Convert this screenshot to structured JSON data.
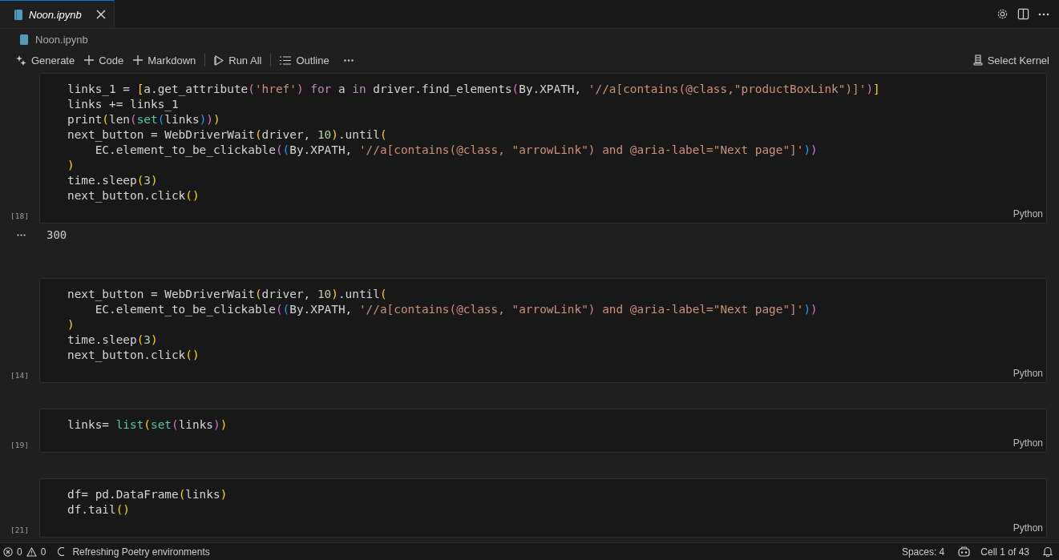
{
  "tabs": [
    {
      "label": "Noon.ipynb",
      "selected": true
    }
  ],
  "breadcrumb": "Noon.ipynb",
  "toolbar": {
    "items": [
      {
        "label": "Generate",
        "kind": "sparkle"
      },
      {
        "label": "Code",
        "kind": "plus"
      },
      {
        "label": "Markdown",
        "kind": "plus"
      },
      {
        "label": "Run All",
        "kind": "run"
      },
      {
        "label": "Outline",
        "kind": "list"
      }
    ],
    "kernel": "Select Kernel"
  },
  "cells": [
    {
      "count": "[18]",
      "language": "Python",
      "lines": [
        [
          {
            "text": "links_1 = ",
            "kind": "plain"
          },
          {
            "text": "[",
            "kind": "bracket1"
          },
          {
            "text": "a.get_attribute",
            "kind": "plain"
          },
          {
            "text": "(",
            "kind": "bracket2"
          },
          {
            "text": "'href'",
            "kind": "string"
          },
          {
            "text": ")",
            "kind": "bracket2"
          },
          {
            "text": " for ",
            "kind": "keyword"
          },
          {
            "text": "a",
            "kind": "plain"
          },
          {
            "text": " in ",
            "kind": "keyword"
          },
          {
            "text": "driver.find_elements",
            "kind": "plain"
          },
          {
            "text": "(",
            "kind": "bracket2"
          },
          {
            "text": "By.XPATH, ",
            "kind": "plain"
          },
          {
            "text": "'//a[contains(@class,\"productBoxLink\")]'",
            "kind": "string"
          },
          {
            "text": ")",
            "kind": "bracket2"
          },
          {
            "text": "]",
            "kind": "bracket1"
          }
        ],
        [
          {
            "text": "links += links_1",
            "kind": "plain"
          }
        ],
        [
          {
            "text": "print",
            "kind": "plain"
          },
          {
            "text": "(",
            "kind": "bracket1"
          },
          {
            "text": "len",
            "kind": "plain"
          },
          {
            "text": "(",
            "kind": "bracket2"
          },
          {
            "text": "set",
            "kind": "builtin"
          },
          {
            "text": "(",
            "kind": "bracket3"
          },
          {
            "text": "links",
            "kind": "plain"
          },
          {
            "text": ")",
            "kind": "bracket3"
          },
          {
            "text": ")",
            "kind": "bracket2"
          },
          {
            "text": ")",
            "kind": "bracket1"
          }
        ],
        [
          {
            "text": "next_button = WebDriverWait",
            "kind": "plain"
          },
          {
            "text": "(",
            "kind": "bracket1"
          },
          {
            "text": "driver, ",
            "kind": "plain"
          },
          {
            "text": "10",
            "kind": "number"
          },
          {
            "text": ")",
            "kind": "bracket1"
          },
          {
            "text": ".until",
            "kind": "plain"
          },
          {
            "text": "(",
            "kind": "bracket1"
          }
        ],
        [
          {
            "text": "    EC.element_to_be_clickable",
            "kind": "plain"
          },
          {
            "text": "(",
            "kind": "bracket2"
          },
          {
            "text": "(",
            "kind": "bracket3"
          },
          {
            "text": "By.XPATH, ",
            "kind": "plain"
          },
          {
            "text": "'//a[contains(@class, \"arrowLink\") and @aria-label=\"Next page\"]'",
            "kind": "string"
          },
          {
            "text": ")",
            "kind": "bracket3"
          },
          {
            "text": ")",
            "kind": "bracket2"
          }
        ],
        [
          {
            "text": ")",
            "kind": "bracket1"
          }
        ],
        [
          {
            "text": "time.sleep",
            "kind": "plain"
          },
          {
            "text": "(",
            "kind": "bracket1"
          },
          {
            "text": "3",
            "kind": "number"
          },
          {
            "text": ")",
            "kind": "bracket1"
          }
        ],
        [
          {
            "text": "next_button.click",
            "kind": "plain"
          },
          {
            "text": "()",
            "kind": "bracket1"
          }
        ]
      ],
      "output": "300"
    },
    {
      "count": "[14]",
      "language": "Python",
      "lines": [
        [
          {
            "text": "next_button = WebDriverWait",
            "kind": "plain"
          },
          {
            "text": "(",
            "kind": "bracket1"
          },
          {
            "text": "driver, ",
            "kind": "plain"
          },
          {
            "text": "10",
            "kind": "number"
          },
          {
            "text": ")",
            "kind": "bracket1"
          },
          {
            "text": ".until",
            "kind": "plain"
          },
          {
            "text": "(",
            "kind": "bracket1"
          }
        ],
        [
          {
            "text": "    EC.element_to_be_clickable",
            "kind": "plain"
          },
          {
            "text": "(",
            "kind": "bracket2"
          },
          {
            "text": "(",
            "kind": "bracket3"
          },
          {
            "text": "By.XPATH, ",
            "kind": "plain"
          },
          {
            "text": "'//a[contains(@class, \"arrowLink\") and @aria-label=\"Next page\"]'",
            "kind": "string"
          },
          {
            "text": ")",
            "kind": "bracket3"
          },
          {
            "text": ")",
            "kind": "bracket2"
          }
        ],
        [
          {
            "text": ")",
            "kind": "bracket1"
          }
        ],
        [
          {
            "text": "time.sleep",
            "kind": "plain"
          },
          {
            "text": "(",
            "kind": "bracket1"
          },
          {
            "text": "3",
            "kind": "number"
          },
          {
            "text": ")",
            "kind": "bracket1"
          }
        ],
        [
          {
            "text": "next_button.click",
            "kind": "plain"
          },
          {
            "text": "()",
            "kind": "bracket1"
          }
        ]
      ]
    },
    {
      "count": "[19]",
      "language": "Python",
      "lines": [
        [
          {
            "text": "links= ",
            "kind": "plain"
          },
          {
            "text": "list",
            "kind": "builtin"
          },
          {
            "text": "(",
            "kind": "bracket1"
          },
          {
            "text": "set",
            "kind": "builtin"
          },
          {
            "text": "(",
            "kind": "bracket2"
          },
          {
            "text": "links",
            "kind": "plain"
          },
          {
            "text": ")",
            "kind": "bracket2"
          },
          {
            "text": ")",
            "kind": "bracket1"
          }
        ]
      ]
    },
    {
      "count": "[21]",
      "language": "Python",
      "lines": [
        [
          {
            "text": "df= pd.DataFrame",
            "kind": "plain"
          },
          {
            "text": "(",
            "kind": "bracket1"
          },
          {
            "text": "links",
            "kind": "plain"
          },
          {
            "text": ")",
            "kind": "bracket1"
          }
        ],
        [
          {
            "text": "df.tail",
            "kind": "plain"
          },
          {
            "text": "()",
            "kind": "bracket1"
          }
        ]
      ]
    }
  ],
  "status": {
    "errors": "0",
    "warnings": "0",
    "message": "Refreshing Poetry environments",
    "spaces": "Spaces: 4",
    "cell": "Cell 1 of 43"
  }
}
